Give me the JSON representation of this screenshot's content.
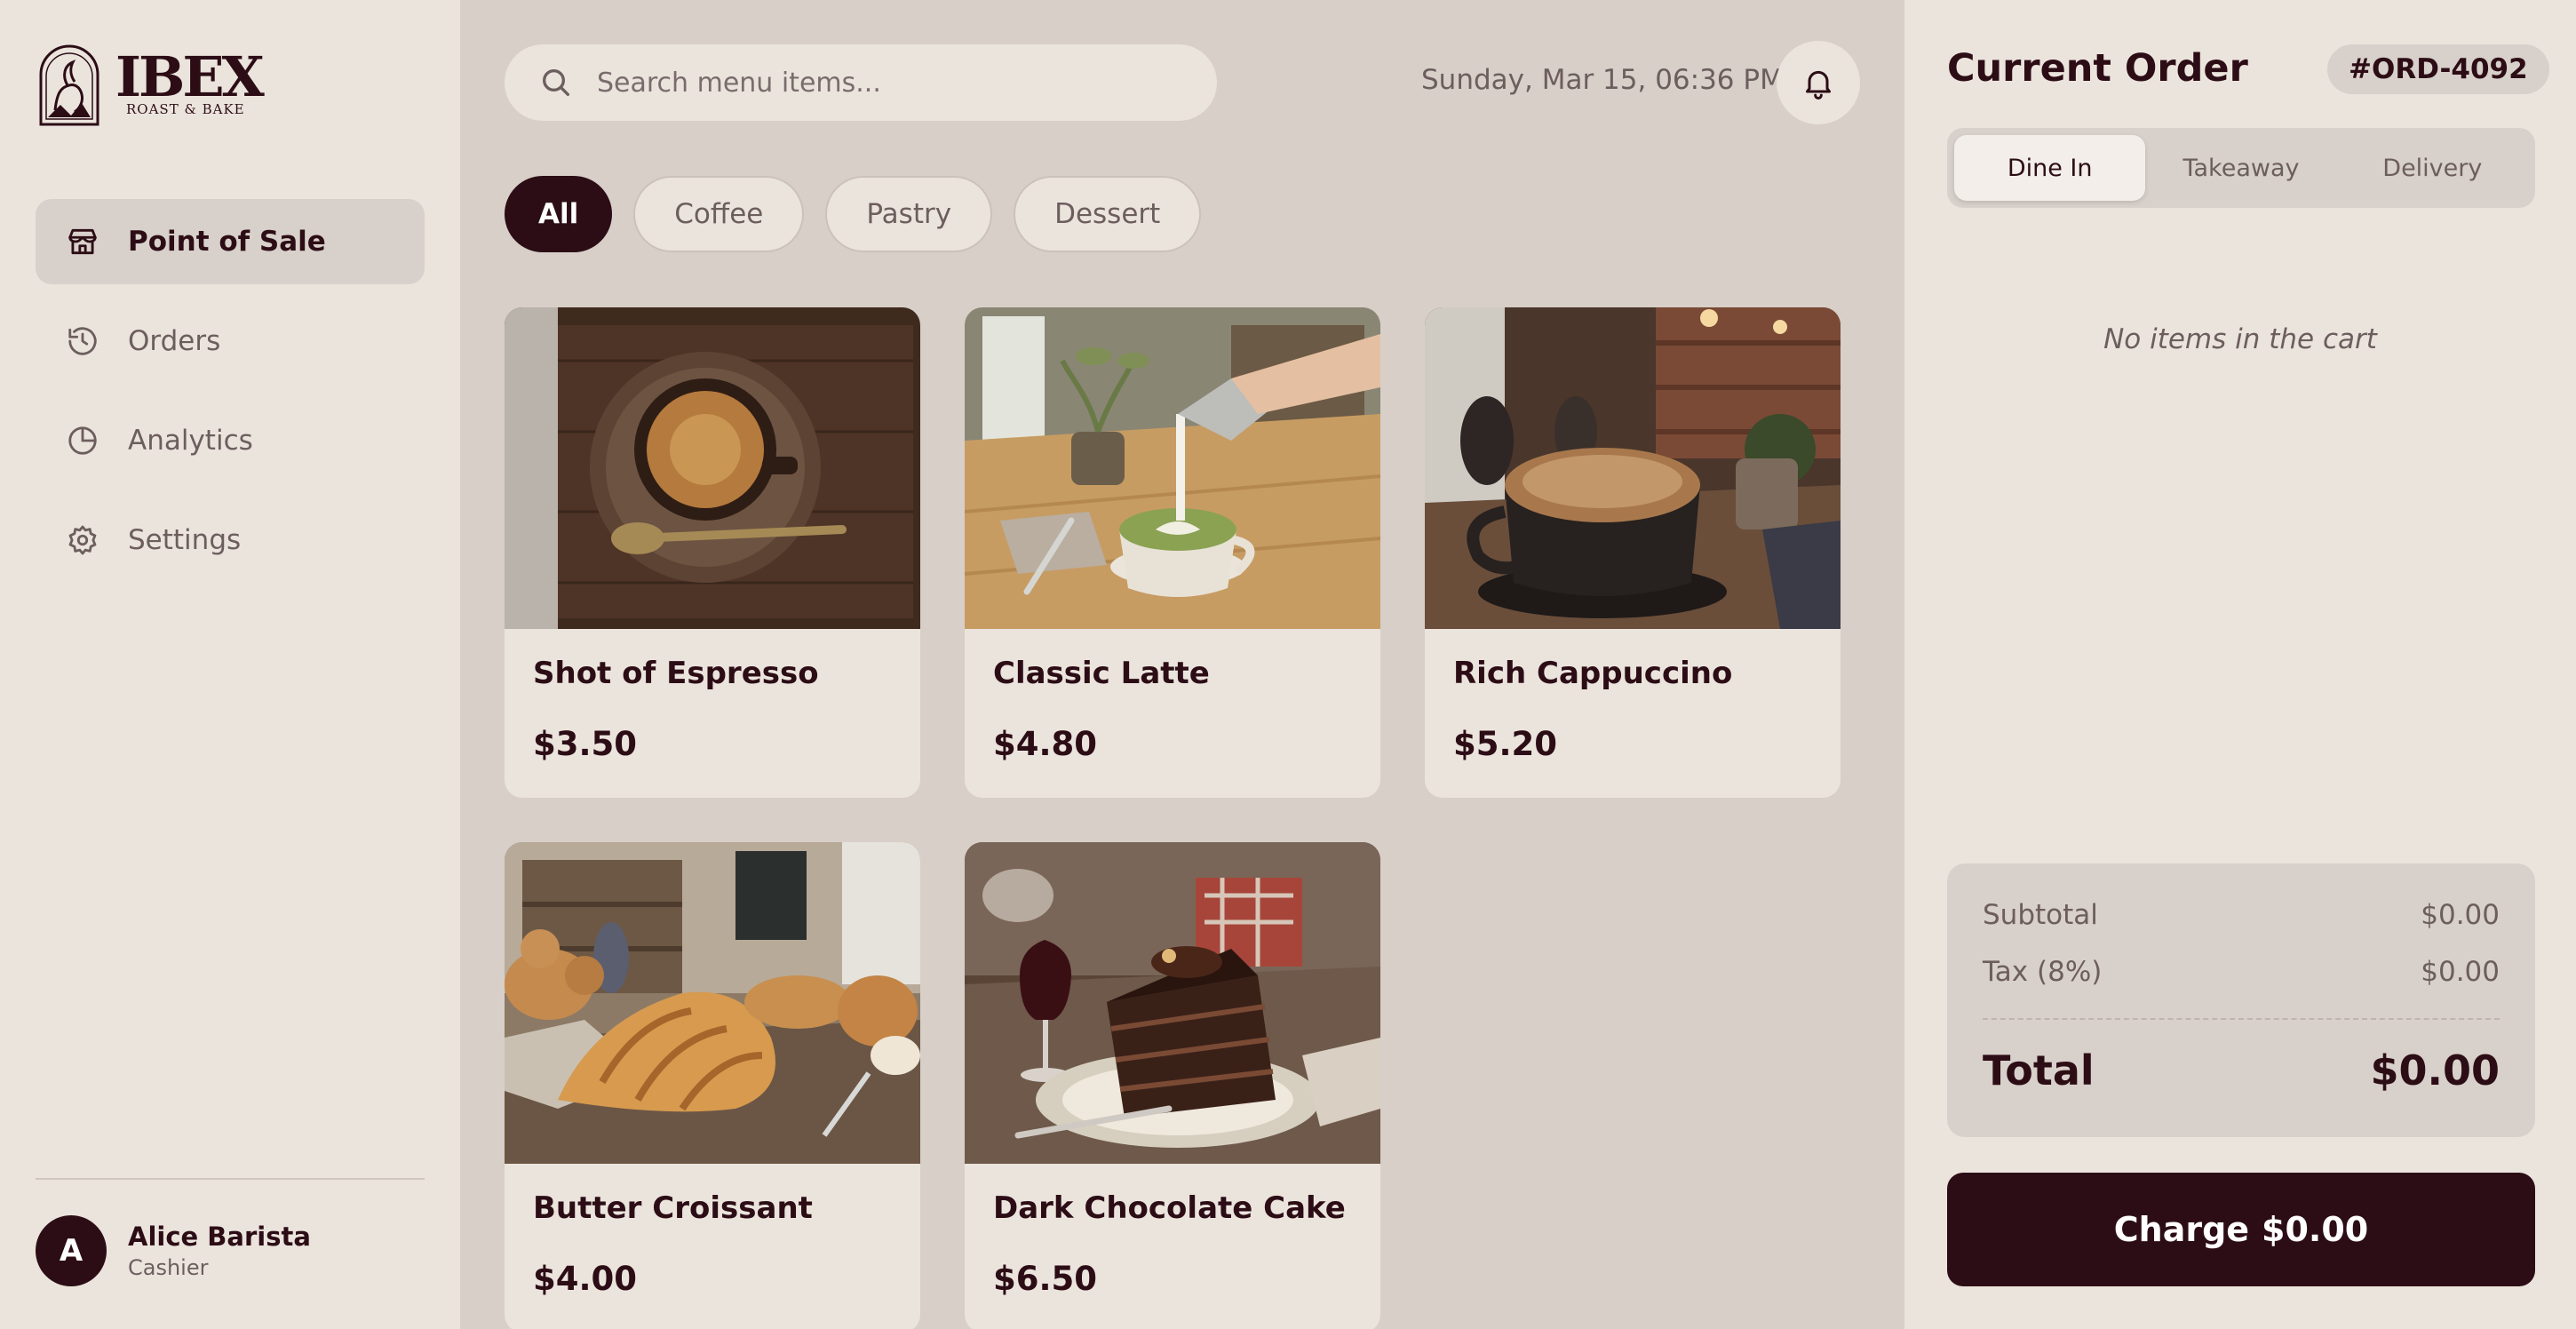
{
  "brand": {
    "name": "IBEX",
    "tagline": "ROAST & BAKE"
  },
  "sidebar": {
    "items": [
      {
        "label": "Point of Sale",
        "icon": "store-icon",
        "active": true
      },
      {
        "label": "Orders",
        "icon": "history-icon",
        "active": false
      },
      {
        "label": "Analytics",
        "icon": "pie-chart-icon",
        "active": false
      },
      {
        "label": "Settings",
        "icon": "gear-icon",
        "active": false
      }
    ],
    "user": {
      "initial": "A",
      "name": "Alice Barista",
      "role": "Cashier"
    }
  },
  "header": {
    "search_placeholder": "Search menu items...",
    "datetime": "Sunday, Mar 15, 06:36 PM"
  },
  "filters": [
    {
      "label": "All",
      "active": true
    },
    {
      "label": "Coffee",
      "active": false
    },
    {
      "label": "Pastry",
      "active": false
    },
    {
      "label": "Dessert",
      "active": false
    }
  ],
  "products": [
    {
      "name": "Shot of Espresso",
      "price": "$3.50"
    },
    {
      "name": "Classic Latte",
      "price": "$4.80"
    },
    {
      "name": "Rich Cappuccino",
      "price": "$5.20"
    },
    {
      "name": "Butter Croissant",
      "price": "$4.00"
    },
    {
      "name": "Dark Chocolate Cake",
      "price": "$6.50"
    }
  ],
  "order": {
    "title": "Current Order",
    "id": "#ORD-4092",
    "tabs": [
      {
        "label": "Dine In",
        "active": true
      },
      {
        "label": "Takeaway",
        "active": false
      },
      {
        "label": "Delivery",
        "active": false
      }
    ],
    "empty_text": "No items in the cart",
    "subtotal_label": "Subtotal",
    "subtotal": "$0.00",
    "tax_label": "Tax (8%)",
    "tax": "$0.00",
    "total_label": "Total",
    "total": "$0.00",
    "charge_label": "Charge",
    "charge_amount": "$0.00"
  },
  "colors": {
    "primary": "#2c0d16",
    "background": "#ebe4dd",
    "muted": "#6d5e5e"
  }
}
